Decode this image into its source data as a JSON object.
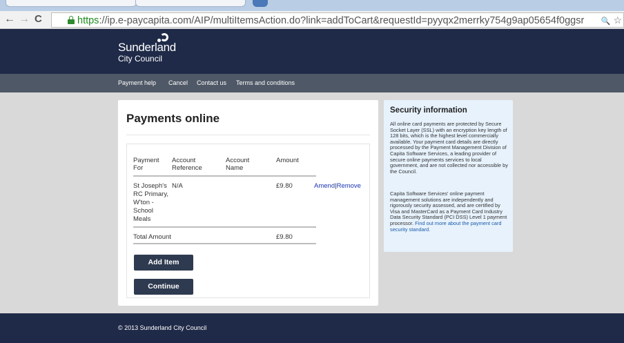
{
  "browser": {
    "url_protocol": "https",
    "url_rest": "://ip.e-paycapita.com/AIP/multiItemsAction.do?link=addToCart&requestId=pyyqx2merrky754g9ap05654f0ggsr",
    "back_glyph": "←",
    "forward_glyph": "→",
    "reload_glyph": "C",
    "search_glyph": "🔍",
    "star_glyph": "☆"
  },
  "header": {
    "brand": "Sunderland",
    "brand_sub": "City Council"
  },
  "nav": {
    "items": [
      "Payment help",
      "Cancel",
      "Contact us",
      "Terms and conditions"
    ]
  },
  "main": {
    "title": "Payments online",
    "columns": [
      "Payment For",
      "Account Reference",
      "Account Name",
      "Amount"
    ],
    "rows": [
      {
        "payment_for": "St Joseph's RC Primary, W'ton - School Meals",
        "reference": "N/A",
        "name": "",
        "amount": "£9.80",
        "amend": "Amend",
        "separator": "|",
        "remove": "Remove"
      }
    ],
    "total_label": "Total Amount",
    "total_value": "£9.80",
    "add_item_label": "Add Item",
    "continue_label": "Continue"
  },
  "security": {
    "title": "Security information",
    "para1": "All online card payments are protected by Secure Socket Layer (SSL) with an encryption key length of 128 bits, which is the highest level commercially available. Your payment card details are directly processed by the Payment Management Division of Capita Software Services, a leading provider of secure online payments services to local government, and are not collected nor accessible by the Council.",
    "para2": "Capita Software Services' online payment management solutions are independently and rigorously security assessed, and are certified by Visa and MasterCard as a Payment Card Industry Data Security Standard (PCI DSS) Level 1 payment processor.",
    "link": "Find out more about the payment card security standard."
  },
  "footer": {
    "text": "© 2013 Sunderland City Council"
  }
}
